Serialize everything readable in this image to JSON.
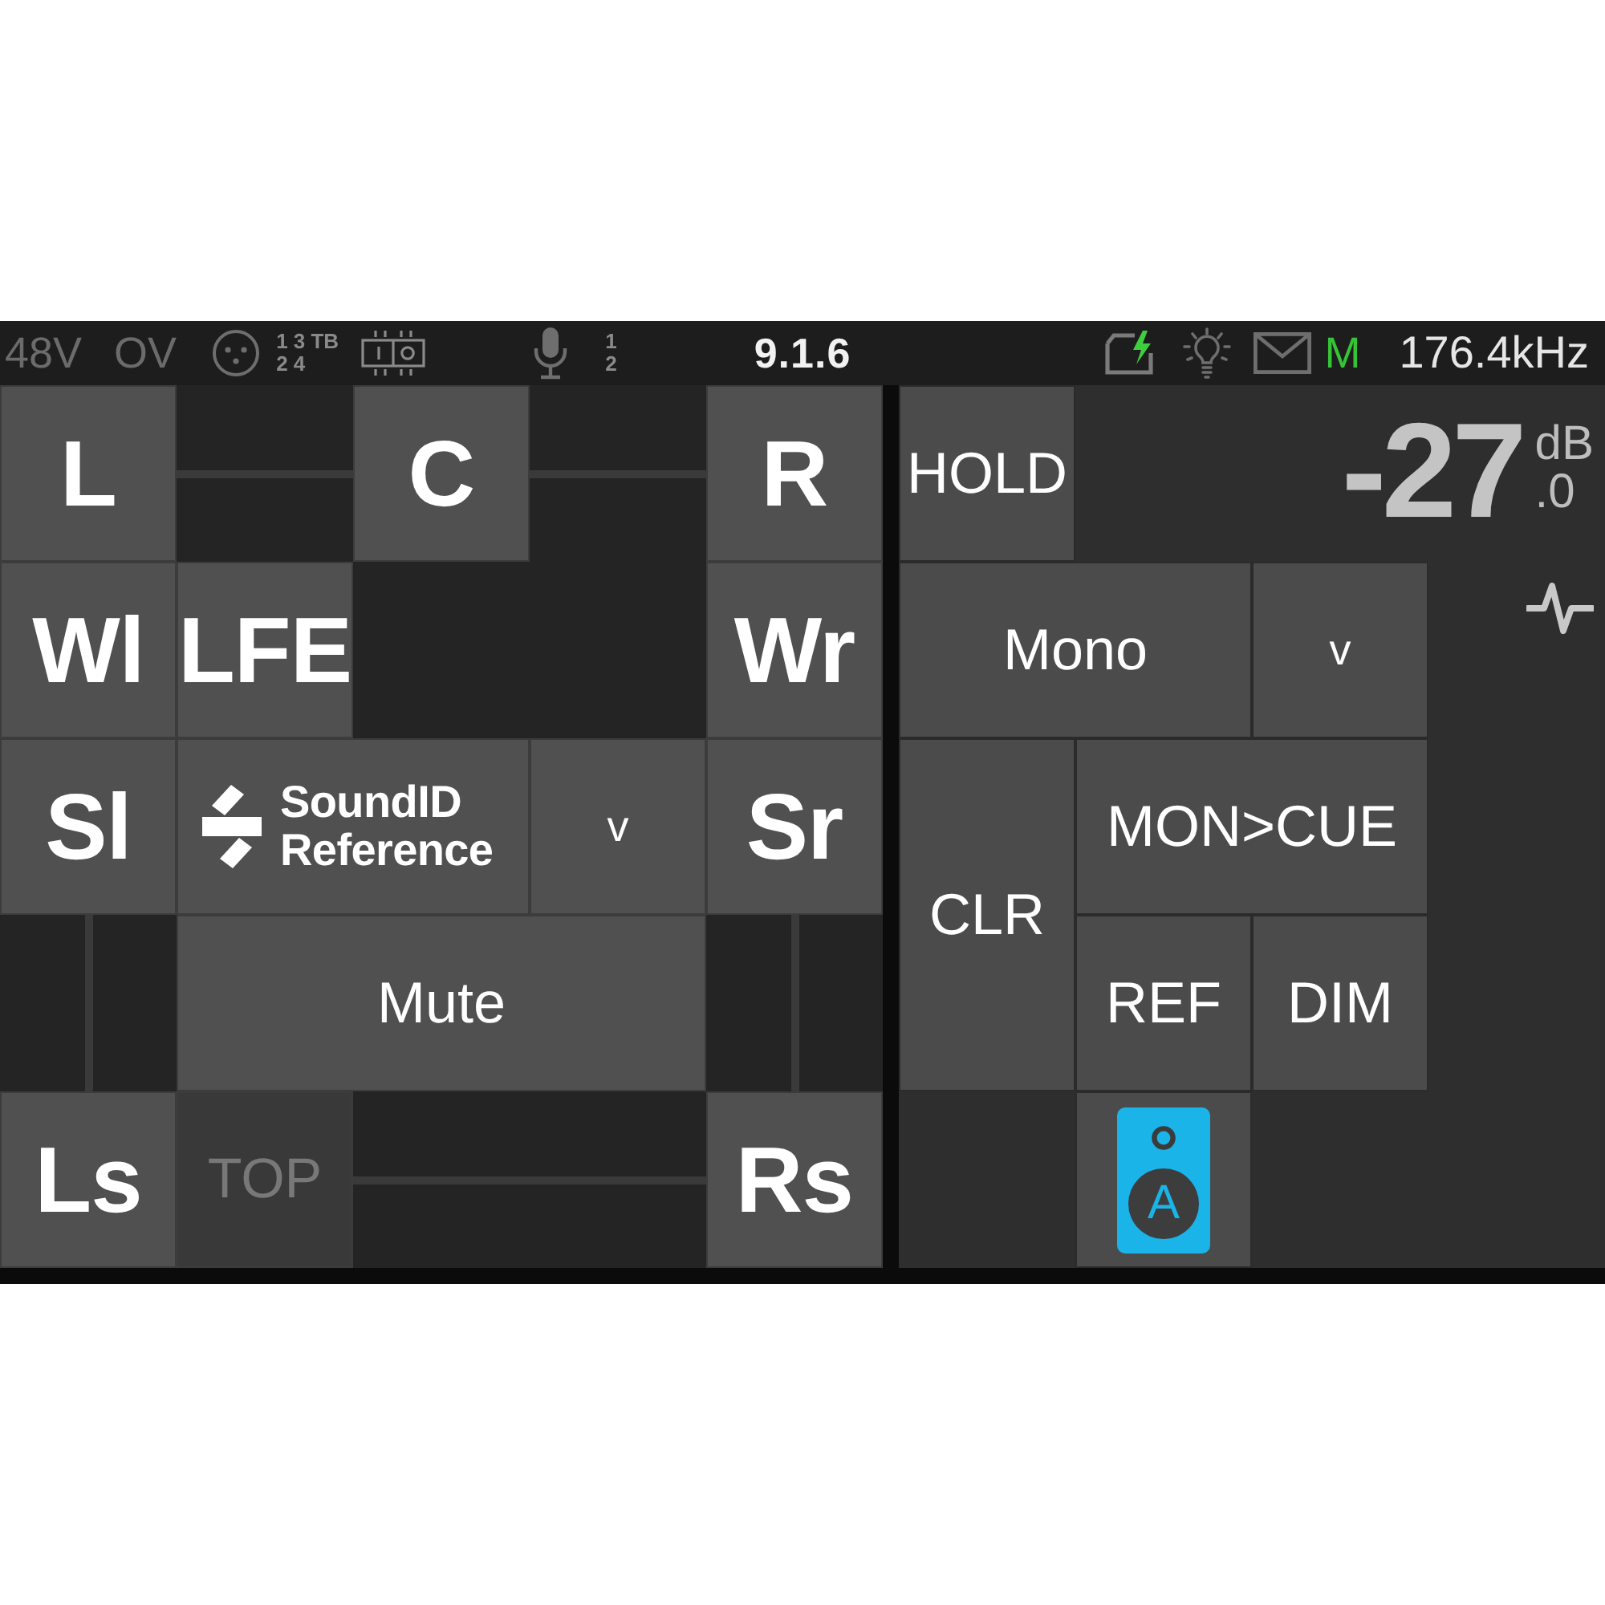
{
  "status_bar": {
    "indicators": [
      {
        "label": "48V",
        "on": false
      },
      {
        "label": "OV",
        "on": false
      }
    ],
    "input_channels": [
      "1 3 TB",
      "2 4"
    ],
    "mic_channels": [
      "1",
      "2"
    ],
    "version": "9.1.6",
    "mode": {
      "label": "M",
      "on": true
    },
    "sample_rate": "176.4kHz"
  },
  "speaker_grid": {
    "speakers": [
      {
        "label": "L",
        "disabled": false
      },
      {
        "label": "C",
        "disabled": false
      },
      {
        "label": "R",
        "disabled": false
      },
      {
        "label": "Wl",
        "disabled": false
      },
      {
        "label": "LFE",
        "disabled": false
      },
      {
        "label": "Wr",
        "disabled": false
      },
      {
        "label": "Sl",
        "disabled": false
      },
      {
        "label": "Sr",
        "disabled": false
      },
      {
        "label": "Ls",
        "disabled": false
      },
      {
        "label": "TOP",
        "disabled": true
      },
      {
        "label": "Rs",
        "disabled": false
      }
    ],
    "soundid_button": {
      "label": "SoundID Reference"
    },
    "soundid_dropdown": {
      "label": "v"
    },
    "mute_button": {
      "label": "Mute"
    }
  },
  "monitor_panel": {
    "hold_button": {
      "label": "HOLD"
    },
    "level_readout": {
      "value": "-27",
      "unit": "dB",
      "fraction": ".0"
    },
    "mono_button": {
      "label": "Mono"
    },
    "mono_dropdown": {
      "label": "v"
    },
    "clear_button": {
      "label": "CLR"
    },
    "mon_cue_button": {
      "label": "MON>CUE"
    },
    "ref_button": {
      "label": "REF"
    },
    "dim_button": {
      "label": "DIM"
    },
    "speaker_set": {
      "label": "A",
      "selected": true
    }
  }
}
